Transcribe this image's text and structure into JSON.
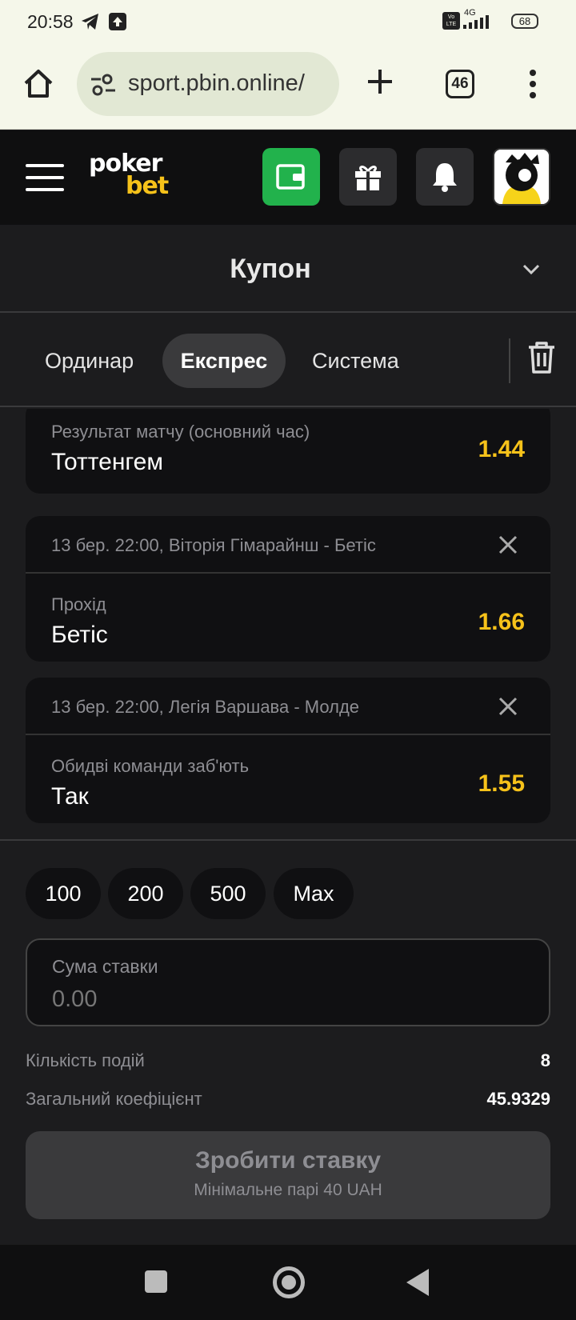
{
  "status_bar": {
    "time": "20:58",
    "network": "4G",
    "volte": "Vo LTE",
    "battery": "68"
  },
  "browser": {
    "url": "sport.pbin.online/",
    "tab_count": "46"
  },
  "app": {
    "logo_top": "poker",
    "logo_bottom": "bet",
    "colors": {
      "accent": "#f6c21a",
      "wallet": "#22b24c"
    }
  },
  "coupon": {
    "title": "Купон",
    "tabs": [
      {
        "label": "Ординар",
        "active": false
      },
      {
        "label": "Експрес",
        "active": true
      },
      {
        "label": "Система",
        "active": false
      }
    ]
  },
  "selections": [
    {
      "event": "",
      "market": "Результат матчу (основний час)",
      "outcome": "Тоттенгем",
      "odd": "1.44"
    },
    {
      "event": "13 бер. 22:00, Віторія Гімарайнш - Бетіс",
      "market": "Прохід",
      "outcome": "Бетіс",
      "odd": "1.66"
    },
    {
      "event": "13 бер. 22:00, Легія Варшава - Молде",
      "market": "Обидві команди заб'ють",
      "outcome": "Так",
      "odd": "1.55"
    }
  ],
  "quick_stakes": [
    "100",
    "200",
    "500",
    "Max"
  ],
  "stake": {
    "label": "Сума ставки",
    "placeholder": "0.00"
  },
  "summary": {
    "events_label": "Кількість подій",
    "events_value": "8",
    "total_odds_label": "Загальний коефіцієнт",
    "total_odds_value": "45.9329"
  },
  "place_bet": {
    "label": "Зробити ставку",
    "sublabel": "Мінімальне парі 40 UAH"
  }
}
